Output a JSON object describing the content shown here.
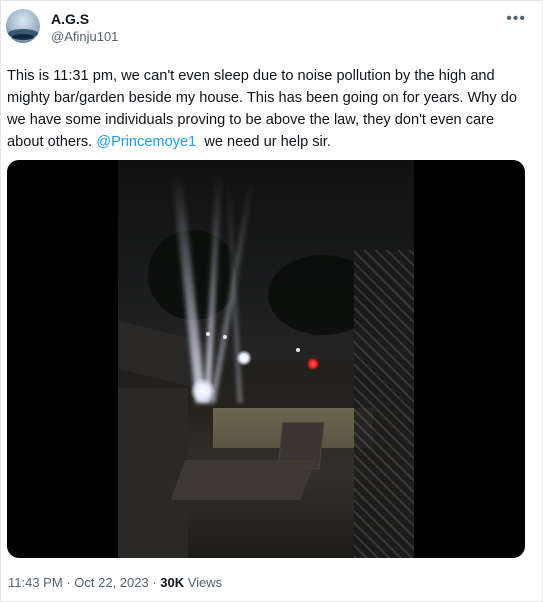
{
  "author": {
    "name": "A.G.S",
    "handle": "@Afinju101"
  },
  "menu_icon": "more-dots-icon",
  "tweet": {
    "text_before_mention": "This is 11:31 pm, we can't even sleep due to noise pollution by the high and mighty bar/garden beside my house. This has been going on for years. Why do we have some individuals proving to be above the law, they don't even care about others. ",
    "mention": "@Princemoye1",
    "text_after_mention": "  we need ur help sir."
  },
  "meta": {
    "time": "11:43 PM",
    "separator": " · ",
    "date": "Oct 22, 2023",
    "views_count": "30K",
    "views_label": " Views"
  }
}
